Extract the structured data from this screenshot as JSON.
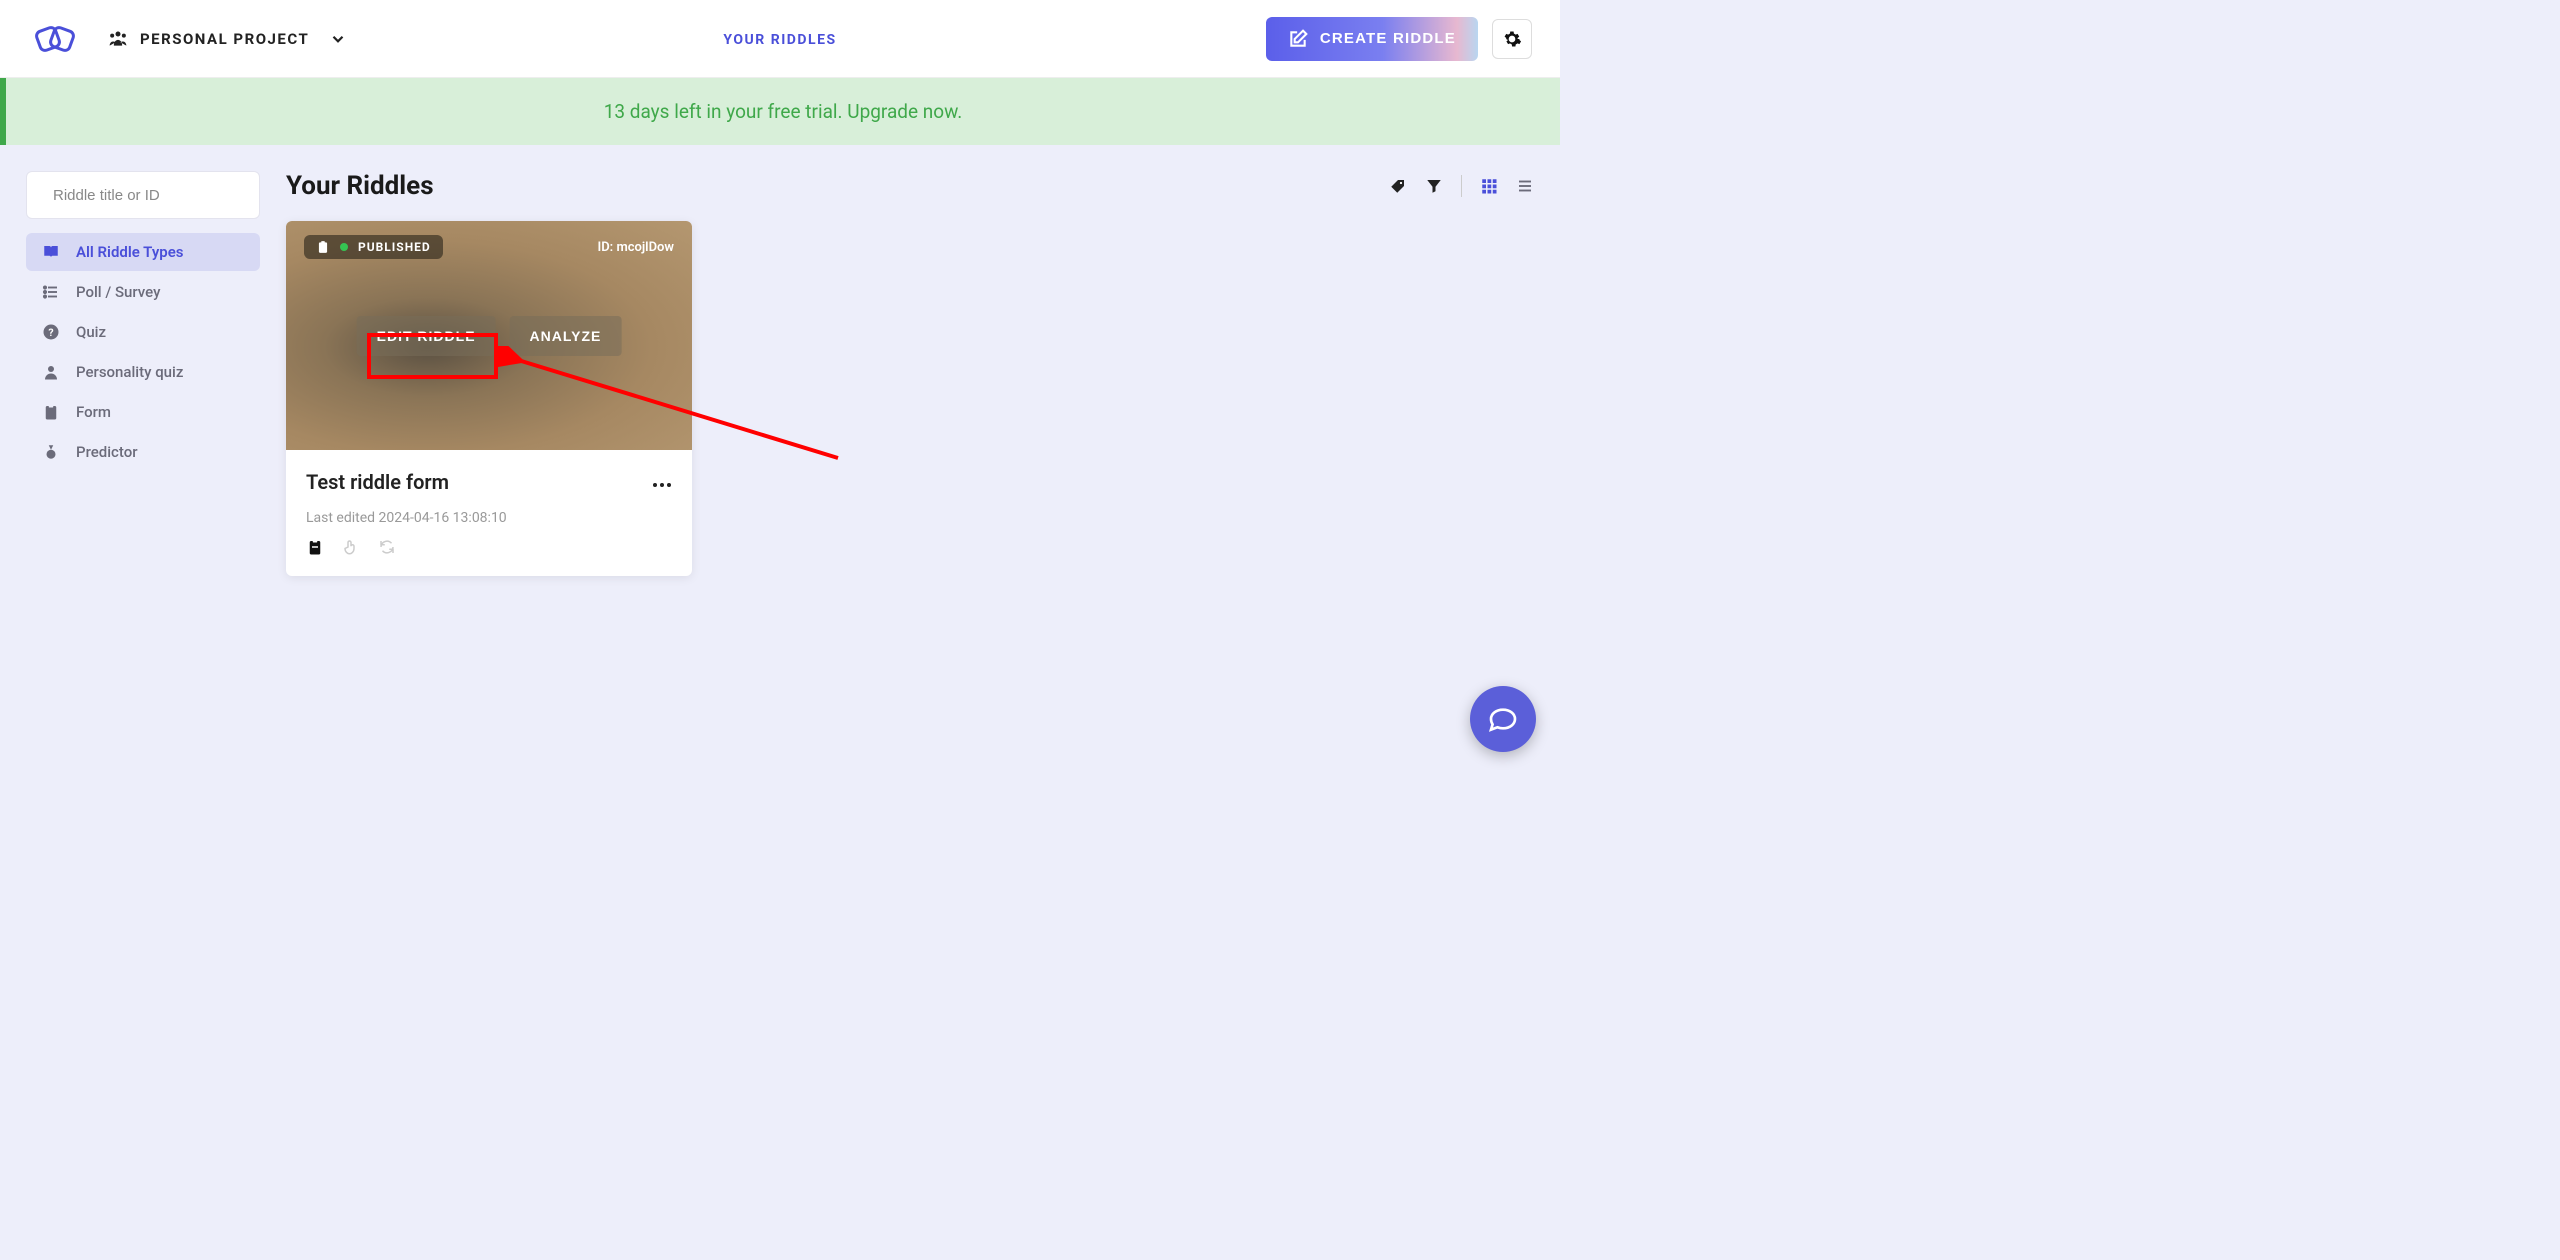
{
  "header": {
    "project_label": "PERSONAL PROJECT",
    "nav_link": "YOUR RIDDLES",
    "create_label": "CREATE RIDDLE"
  },
  "banner": {
    "text": "13 days left in your free trial. Upgrade now."
  },
  "search": {
    "placeholder": "Riddle title or ID"
  },
  "sidebar": {
    "items": [
      {
        "label": "All Riddle Types",
        "icon": "book-open",
        "active": true
      },
      {
        "label": "Poll / Survey",
        "icon": "list",
        "active": false
      },
      {
        "label": "Quiz",
        "icon": "question-circle",
        "active": false
      },
      {
        "label": "Personality quiz",
        "icon": "user",
        "active": false
      },
      {
        "label": "Form",
        "icon": "clipboard",
        "active": false
      },
      {
        "label": "Predictor",
        "icon": "medal",
        "active": false
      }
    ]
  },
  "content": {
    "title": "Your Riddles"
  },
  "card": {
    "status": "PUBLISHED",
    "id_prefix": "ID: ",
    "id": "mcojlDow",
    "edit_label": "EDIT RIDDLE",
    "analyze_label": "ANALYZE",
    "title": "Test riddle form",
    "last_edited": "Last edited 2024-04-16 13:08:10"
  }
}
